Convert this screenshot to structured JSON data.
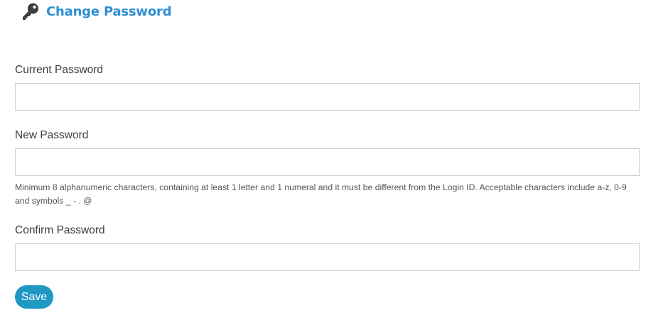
{
  "header": {
    "icon": "key-icon",
    "title": "Change Password"
  },
  "form": {
    "current_password": {
      "label": "Current Password",
      "value": "",
      "placeholder": ""
    },
    "new_password": {
      "label": "New Password",
      "value": "",
      "placeholder": "",
      "hint": "Minimum 8 alphanumeric characters, containing at least 1 letter and 1 numeral and it must be different from the Login ID. Acceptable characters include a-z, 0-9 and symbols _ - . @"
    },
    "confirm_password": {
      "label": "Confirm Password",
      "value": "",
      "placeholder": ""
    },
    "save_label": "Save"
  },
  "colors": {
    "title": "#2f8fd3",
    "button": "#1f98c4",
    "input_border": "#cfcfcf",
    "icon": "#3b3b3b"
  }
}
